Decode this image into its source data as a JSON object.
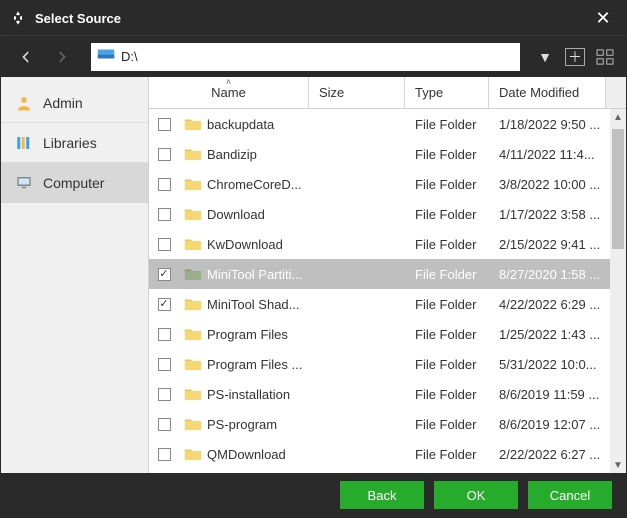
{
  "window": {
    "title": "Select Source"
  },
  "nav": {
    "path": "D:\\"
  },
  "sidebar": {
    "items": [
      {
        "label": "Admin",
        "icon": "user"
      },
      {
        "label": "Libraries",
        "icon": "libraries"
      },
      {
        "label": "Computer",
        "icon": "computer"
      }
    ],
    "activeIndex": 2
  },
  "columns": {
    "name": "Name",
    "size": "Size",
    "type": "Type",
    "date": "Date Modified",
    "sort": {
      "column": "name",
      "direction": "asc"
    }
  },
  "files": [
    {
      "checked": false,
      "name": "backupdata",
      "size": "",
      "type": "File Folder",
      "date": "1/18/2022 9:50 ...",
      "selected": false
    },
    {
      "checked": false,
      "name": "Bandizip",
      "size": "",
      "type": "File Folder",
      "date": "4/11/2022 11:4...",
      "selected": false
    },
    {
      "checked": false,
      "name": "ChromeCoreD...",
      "size": "",
      "type": "File Folder",
      "date": "3/8/2022 10:00 ...",
      "selected": false
    },
    {
      "checked": false,
      "name": "Download",
      "size": "",
      "type": "File Folder",
      "date": "1/17/2022 3:58 ...",
      "selected": false
    },
    {
      "checked": false,
      "name": "KwDownload",
      "size": "",
      "type": "File Folder",
      "date": "2/15/2022 9:41 ...",
      "selected": false
    },
    {
      "checked": true,
      "name": "MiniTool Partiti...",
      "size": "",
      "type": "File Folder",
      "date": "8/27/2020 1:58 ...",
      "selected": true
    },
    {
      "checked": true,
      "name": "MiniTool Shad...",
      "size": "",
      "type": "File Folder",
      "date": "4/22/2022 6:29 ...",
      "selected": false
    },
    {
      "checked": false,
      "name": "Program Files",
      "size": "",
      "type": "File Folder",
      "date": "1/25/2022 1:43 ...",
      "selected": false
    },
    {
      "checked": false,
      "name": "Program Files ...",
      "size": "",
      "type": "File Folder",
      "date": "5/31/2022 10:0...",
      "selected": false
    },
    {
      "checked": false,
      "name": "PS-installation",
      "size": "",
      "type": "File Folder",
      "date": "8/6/2019 11:59 ...",
      "selected": false
    },
    {
      "checked": false,
      "name": "PS-program",
      "size": "",
      "type": "File Folder",
      "date": "8/6/2019 12:07 ...",
      "selected": false
    },
    {
      "checked": false,
      "name": "QMDownload",
      "size": "",
      "type": "File Folder",
      "date": "2/22/2022 6:27 ...",
      "selected": false
    }
  ],
  "footer": {
    "back": "Back",
    "ok": "OK",
    "cancel": "Cancel"
  },
  "colors": {
    "accent": "#26ab2d",
    "selection": "#bfbfbf",
    "chrome": "#2a2a2a"
  }
}
